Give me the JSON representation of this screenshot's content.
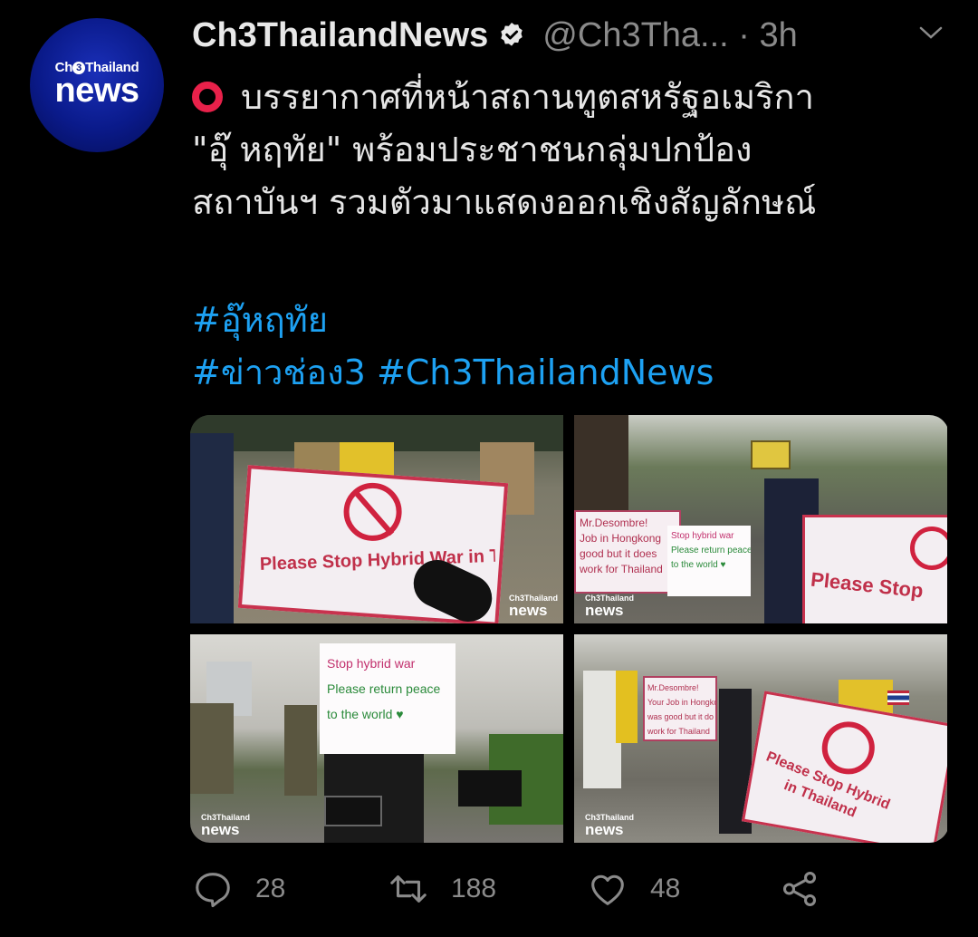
{
  "tweet": {
    "avatar": {
      "line1_left": "Ch",
      "line1_circle": "3",
      "line1_right": "Thailand",
      "line2": "news"
    },
    "display_name": "Ch3ThailandNews",
    "handle": "@Ch3Tha...",
    "time": "· 3h",
    "text_lines": [
      "บรรยากาศที่หน้าสถานทูตสหรัฐอเมริกา",
      "\"อุ๊ หฤทัย\" พร้อมประชาชนกลุ่มปกป้อง",
      "สถาบันฯ รวมตัวมาแสดงออกเชิงสัญลักษณ์"
    ],
    "hashtags": {
      "line1": [
        "#อุ๊หฤทัย"
      ],
      "line2": [
        "#ข่าวช่อง3",
        "#Ch3ThailandNews"
      ]
    }
  },
  "media": {
    "watermark_small": "Ch3Thailand",
    "watermark_big": "news",
    "photo1_sign": "Please Stop Hybrid War in Thailand",
    "photo2_sign_a": [
      "Mr.Desombre!",
      "Job in Hongkong",
      "good but it does",
      "work for Thailand"
    ],
    "photo2_sign_b": [
      "Stop hybrid war",
      "Please return peace",
      "to the world ♥"
    ],
    "photo2_sign_c": "Please Stop",
    "photo3_sign": [
      "Stop hybrid war",
      "Please return peace",
      "to the world ♥"
    ],
    "photo4_sign_a": [
      "Mr.Desombre!",
      "Your Job in Hongkong",
      "was good but it do",
      "work for Thailand"
    ],
    "photo4_sign_c": [
      "Please Stop Hybrid",
      "in Thailand"
    ]
  },
  "actions": {
    "replies": "28",
    "retweets": "188",
    "likes": "48"
  },
  "colors": {
    "background": "#000000",
    "link": "#1da1f2",
    "muted": "#8a8a8a",
    "red_circle": "#e8214a"
  },
  "icons": [
    "verified-badge-icon",
    "chevron-down-icon",
    "red-circle-emoji-icon",
    "reply-icon",
    "retweet-icon",
    "like-icon",
    "share-icon"
  ]
}
